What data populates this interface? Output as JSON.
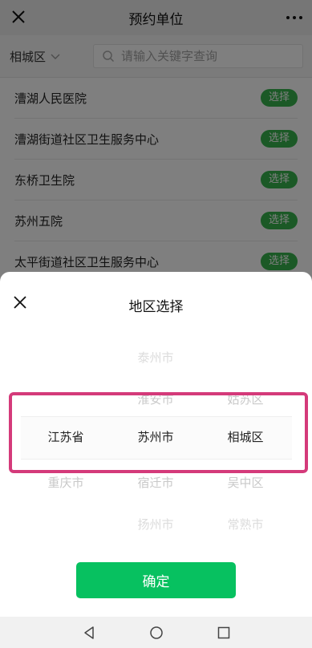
{
  "header": {
    "title": "预约单位",
    "close_icon": "close-icon",
    "more_icon": "more-icon"
  },
  "filter": {
    "region": "相城区",
    "search_placeholder": "请输入关键字查询"
  },
  "list": [
    {
      "name": "漕湖人民医院",
      "button": "选择"
    },
    {
      "name": "漕湖街道社区卫生服务中心",
      "button": "选择"
    },
    {
      "name": "东桥卫生院",
      "button": "选择"
    },
    {
      "name": "苏州五院",
      "button": "选择"
    },
    {
      "name": "太平街道社区卫生服务中心",
      "button": "选择"
    }
  ],
  "sheet": {
    "title": "地区选择",
    "province": {
      "above": "",
      "selected": "江苏省",
      "below": "重庆市"
    },
    "city": {
      "above2": "泰州市",
      "above": "淮安市",
      "selected": "苏州市",
      "below": "宿迁市",
      "below2": "扬州市"
    },
    "district": {
      "above": "姑苏区",
      "selected": "相城区",
      "below": "吴中区",
      "below2": "常熟市"
    },
    "confirm": "确定"
  },
  "colors": {
    "accent": "#07c160",
    "select_button": "#37b24d",
    "highlight": "#d43a7a"
  },
  "navbar": {
    "back": "back-icon",
    "home": "home-icon",
    "recents": "recents-icon"
  }
}
